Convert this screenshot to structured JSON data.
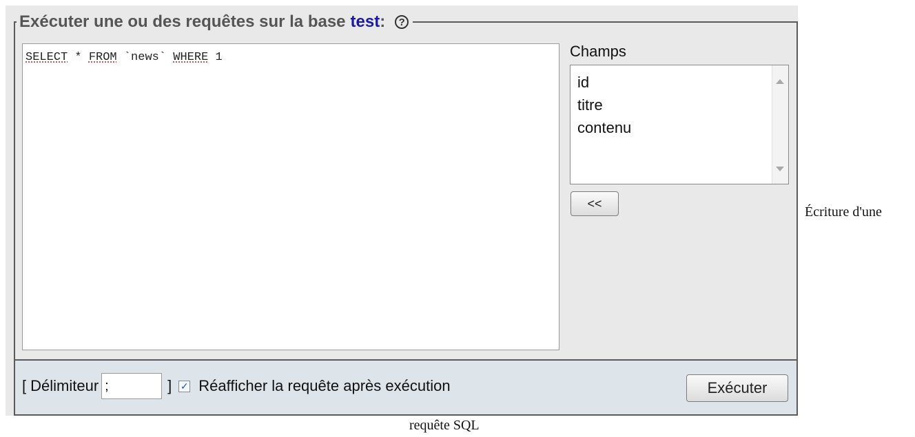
{
  "legend": {
    "text": "Exécuter une ou des requêtes sur la base",
    "database": "test",
    "colon": ":",
    "help_glyph": "?"
  },
  "query": {
    "tokens": [
      "SELECT",
      " * ",
      "FROM",
      " `news` ",
      "WHERE",
      " 1"
    ]
  },
  "fields": {
    "label": "Champs",
    "items": [
      "id",
      "titre",
      "contenu"
    ]
  },
  "insert_button": {
    "label": "<<"
  },
  "footer": {
    "open_bracket": "[",
    "delimiter_label": "Délimiteur",
    "delimiter_value": ";",
    "close_bracket": "]",
    "show_query_checked": true,
    "check_glyph": "✓",
    "show_query_label": "Réafficher la requête après exécution",
    "execute_label": "Exécuter"
  },
  "caption": {
    "line1": "Écriture d'une",
    "line2": "requête SQL"
  },
  "icons": {
    "help": "help-circle-icon",
    "scroll_up": "arrow-up-icon",
    "scroll_down": "arrow-down-icon",
    "checkbox": "check-icon"
  },
  "colors": {
    "panel_background": "#e9e9e9",
    "footer_background": "#dde4ea",
    "database_name": "#1a1aa6"
  }
}
